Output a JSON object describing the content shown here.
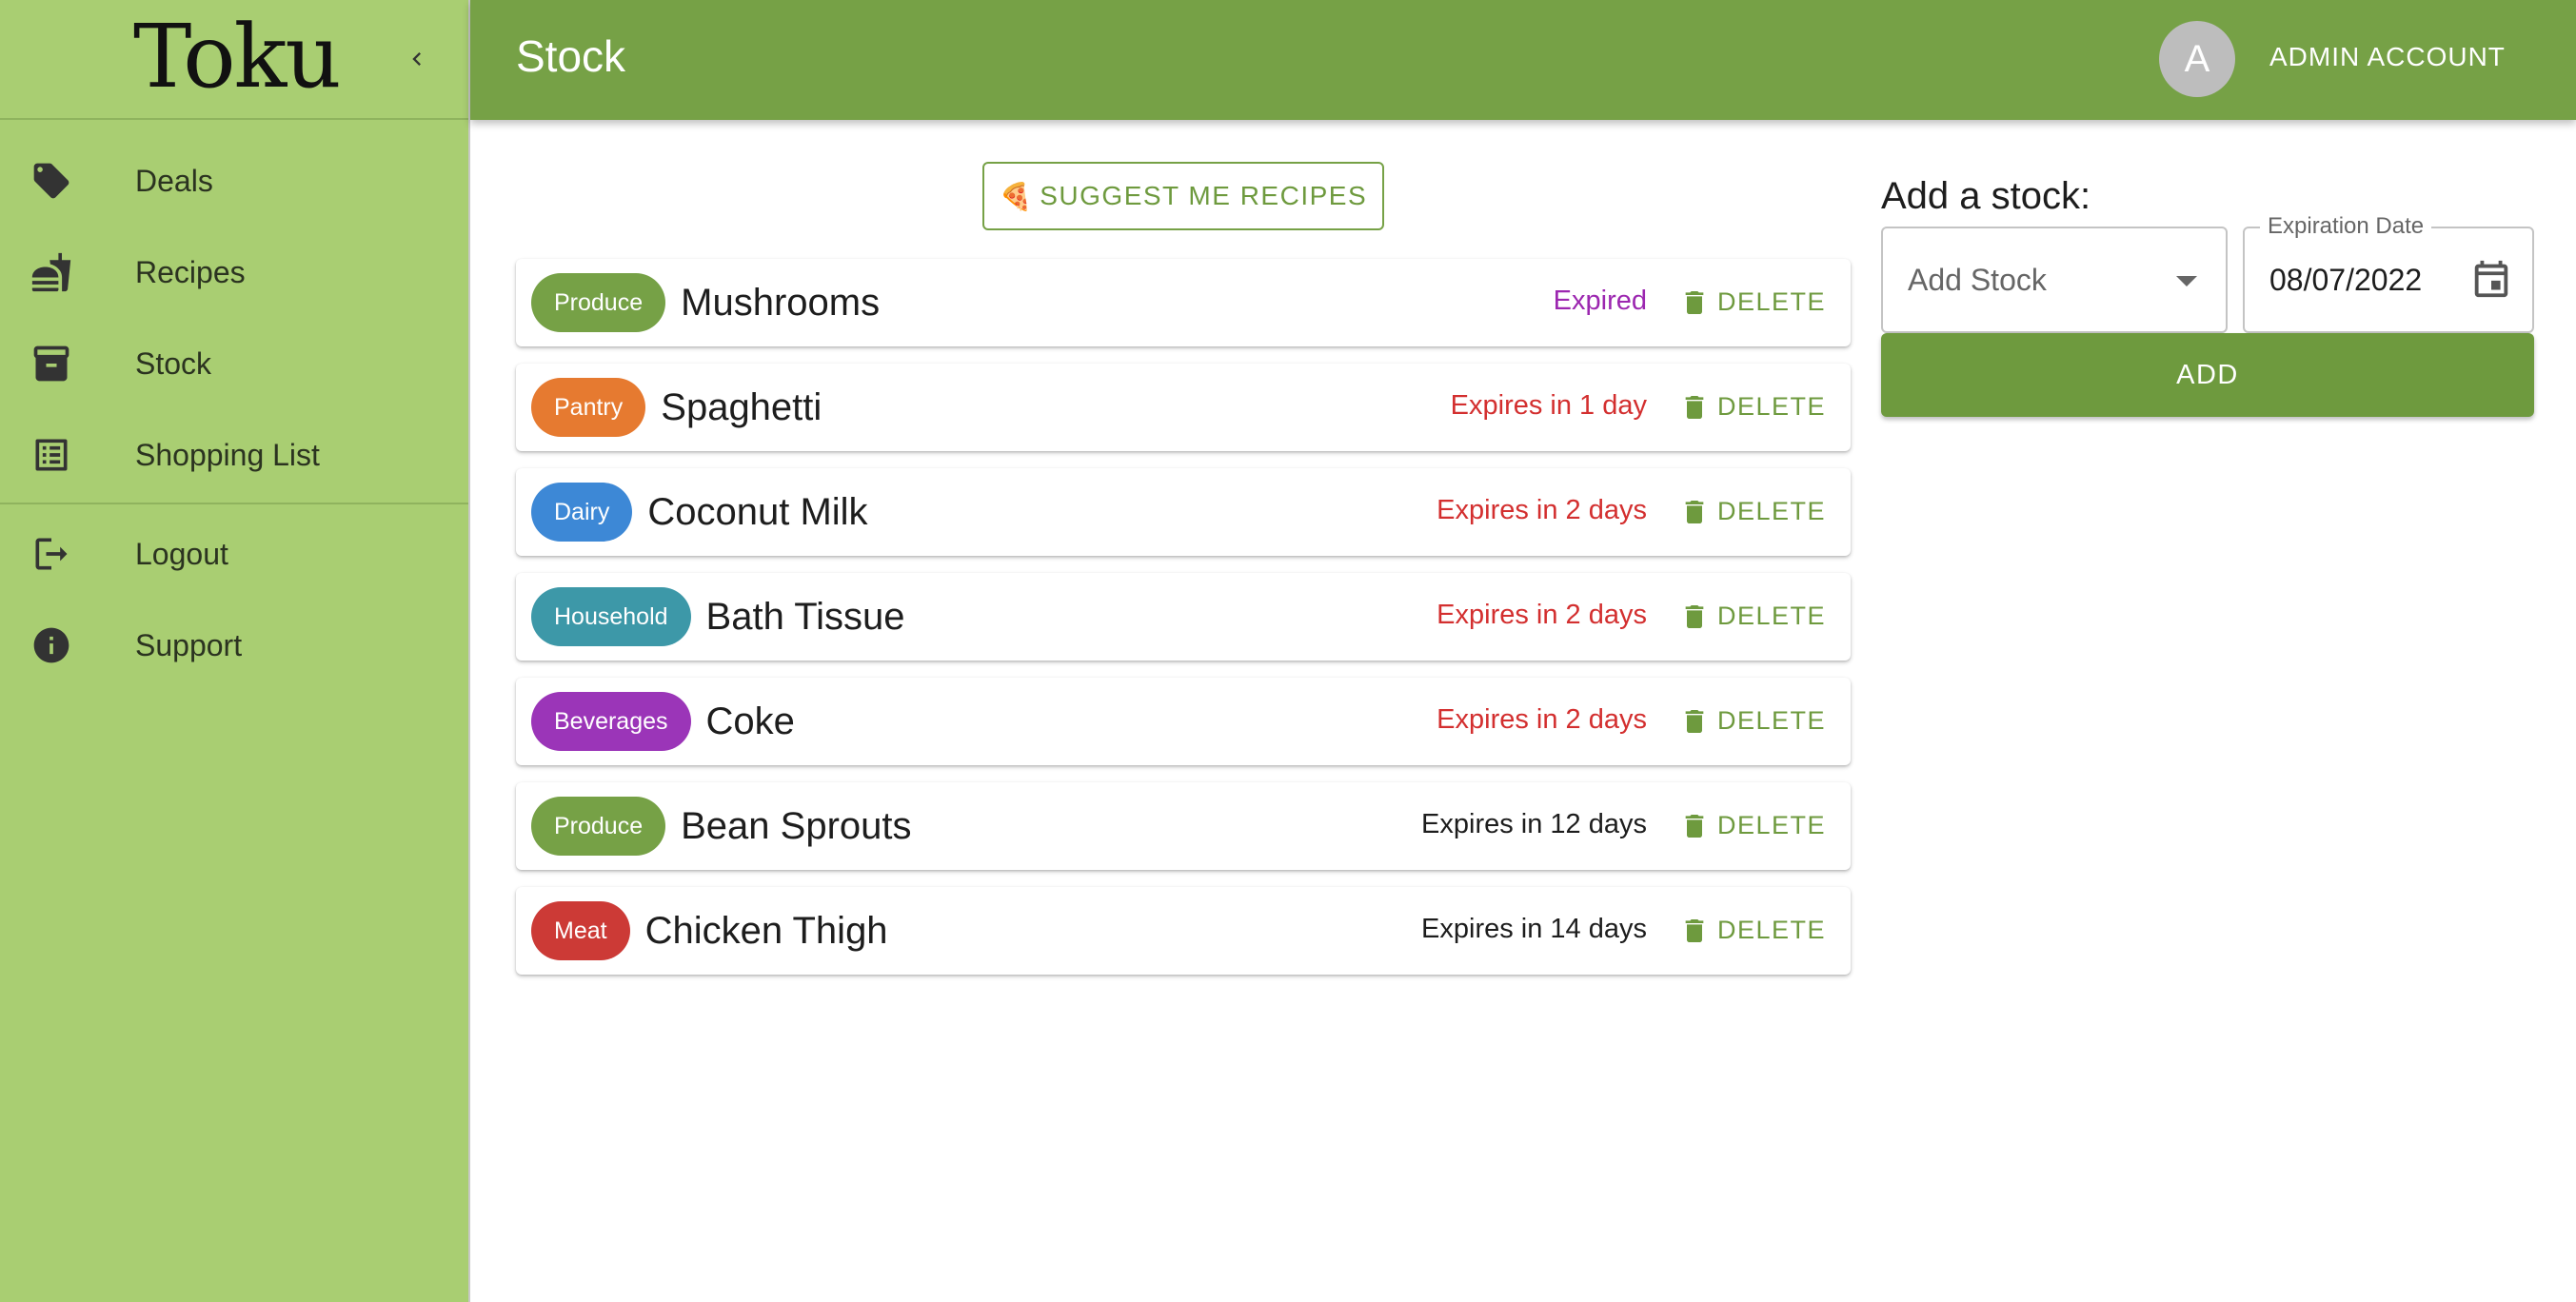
{
  "app": {
    "brand": "Toku"
  },
  "sidebar": {
    "items": [
      {
        "label": "Deals",
        "icon": "tag-icon"
      },
      {
        "label": "Recipes",
        "icon": "fastfood-icon"
      },
      {
        "label": "Stock",
        "icon": "archive-box-icon"
      },
      {
        "label": "Shopping List",
        "icon": "list-icon"
      },
      {
        "label": "Logout",
        "icon": "logout-icon"
      },
      {
        "label": "Support",
        "icon": "info-icon"
      }
    ]
  },
  "header": {
    "title": "Stock",
    "avatar_initial": "A",
    "account_name": "ADMIN ACCOUNT"
  },
  "main": {
    "suggest_label": "SUGGEST ME RECIPES",
    "suggest_emoji": "🍕",
    "delete_label": "DELETE",
    "stock_items": [
      {
        "category": "Produce",
        "category_color": "#76a146",
        "name": "Mushrooms",
        "expiry": "Expired",
        "expiry_color": "#9c27b0"
      },
      {
        "category": "Pantry",
        "category_color": "#e67a30",
        "name": "Spaghetti",
        "expiry": "Expires in 1 day",
        "expiry_color": "#d32f2f"
      },
      {
        "category": "Dairy",
        "category_color": "#3d88d6",
        "name": "Coconut Milk",
        "expiry": "Expires in 2 days",
        "expiry_color": "#d32f2f"
      },
      {
        "category": "Household",
        "category_color": "#3d98a8",
        "name": "Bath Tissue",
        "expiry": "Expires in 2 days",
        "expiry_color": "#d32f2f"
      },
      {
        "category": "Beverages",
        "category_color": "#9b35b8",
        "name": "Coke",
        "expiry": "Expires in 2 days",
        "expiry_color": "#d32f2f"
      },
      {
        "category": "Produce",
        "category_color": "#76a146",
        "name": "Bean Sprouts",
        "expiry": "Expires in 12 days",
        "expiry_color": "#1d1d1d"
      },
      {
        "category": "Meat",
        "category_color": "#cc3a36",
        "name": "Chicken Thigh",
        "expiry": "Expires in 14 days",
        "expiry_color": "#1d1d1d"
      }
    ]
  },
  "add_form": {
    "title": "Add a stock:",
    "select_placeholder": "Add Stock",
    "date_label": "Expiration Date",
    "date_value": "08/07/2022",
    "add_label": "ADD"
  },
  "colors": {
    "sidebar_bg": "#a9ce72",
    "header_bg": "#76a146",
    "accent": "#6e9a3e"
  }
}
